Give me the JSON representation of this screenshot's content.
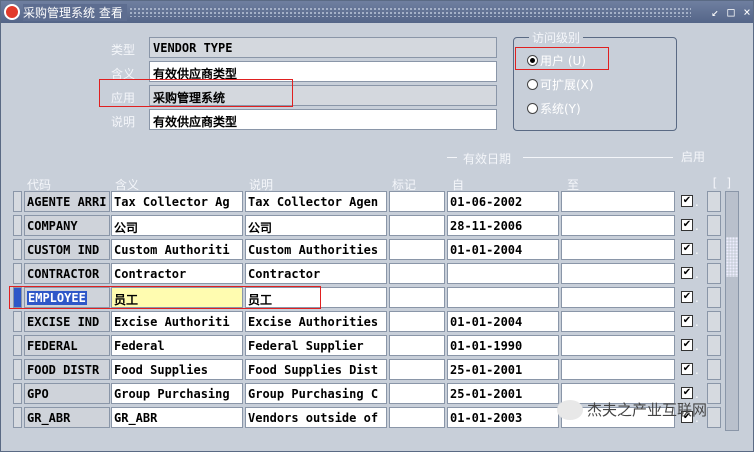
{
  "window": {
    "title": "采购管理系统 查看",
    "btn_restore": "↙",
    "btn_max": "□",
    "btn_close": "×"
  },
  "form": {
    "type_label": "类型",
    "type_value": "VENDOR TYPE",
    "meaning_label": "含义",
    "meaning_value": "有效供应商类型",
    "app_label": "应用",
    "app_value": "采购管理系统",
    "desc_label": "说明",
    "desc_value": "有效供应商类型"
  },
  "access": {
    "title": "访问级别",
    "options": [
      "用户 (U)",
      "可扩展(X)",
      "系统(Y)"
    ],
    "selected": 0
  },
  "table": {
    "group_header": "有效日期",
    "enabled_header": "启用",
    "headers": {
      "code": "代码",
      "meaning": "含义",
      "desc": "说明",
      "tag": "标记",
      "from": "自",
      "to": "至",
      "dff": "[ ]"
    },
    "rows": [
      {
        "code": "AGENTE ARRI",
        "meaning": "Tax Collector Ag",
        "desc": "Tax Collector Agen",
        "tag": "",
        "from": "01-06-2002",
        "to": "",
        "enabled": true
      },
      {
        "code": "COMPANY",
        "meaning": "公司",
        "desc": "公司",
        "tag": "",
        "from": "28-11-2006",
        "to": "",
        "enabled": true
      },
      {
        "code": "CUSTOM IND",
        "meaning": "Custom Authoriti",
        "desc": "Custom Authorities",
        "tag": "",
        "from": "01-01-2004",
        "to": "",
        "enabled": true
      },
      {
        "code": "CONTRACTOR",
        "meaning": "Contractor",
        "desc": "Contractor",
        "tag": "",
        "from": "",
        "to": "",
        "enabled": true
      },
      {
        "code": "EMPLOYEE",
        "meaning": "员工",
        "desc": "员工",
        "tag": "",
        "from": "",
        "to": "",
        "enabled": true
      },
      {
        "code": "EXCISE IND",
        "meaning": "Excise Authoriti",
        "desc": "Excise Authorities",
        "tag": "",
        "from": "01-01-2004",
        "to": "",
        "enabled": true
      },
      {
        "code": "FEDERAL",
        "meaning": "Federal",
        "desc": "Federal Supplier",
        "tag": "",
        "from": "01-01-1990",
        "to": "",
        "enabled": true
      },
      {
        "code": "FOOD DISTR",
        "meaning": "Food Supplies",
        "desc": "Food Supplies Dist",
        "tag": "",
        "from": "25-01-2001",
        "to": "",
        "enabled": true
      },
      {
        "code": "GPO",
        "meaning": "Group Purchasing",
        "desc": "Group Purchasing C",
        "tag": "",
        "from": "25-01-2001",
        "to": "",
        "enabled": true
      },
      {
        "code": "GR_ABR",
        "meaning": "GR_ABR",
        "desc": "Vendors outside of",
        "tag": "",
        "from": "01-01-2003",
        "to": "",
        "enabled": true
      }
    ],
    "current_row": 4
  },
  "watermark": "杰夫之产业互联网",
  "colors": {
    "window_bg": "#c8cfd9",
    "titlebar": "#5d6d90",
    "highlight_red": "#e02020",
    "selection_blue": "#2e57c8"
  }
}
